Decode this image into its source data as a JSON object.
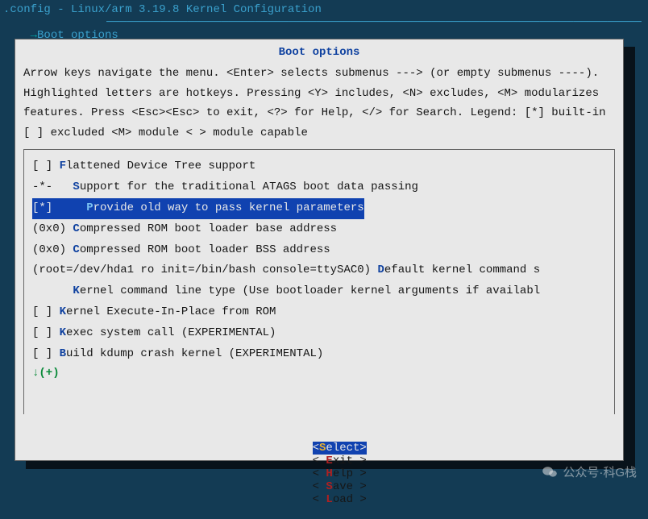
{
  "window_title": ".config - Linux/arm 3.19.8 Kernel Configuration",
  "breadcrumb": {
    "arrow": "→",
    "label": "Boot options"
  },
  "panel": {
    "title": "Boot options",
    "help": "Arrow keys navigate the menu.  <Enter> selects submenus ---> (or empty submenus ----).  Highlighted letters are hotkeys.  Pressing <Y> includes, <N> excludes, <M> modularizes features.  Press <Esc><Esc> to exit, <?> for Help, </> for Search.  Legend: [*] built-in  [ ] excluded  <M> module  < > module capable"
  },
  "options": [
    {
      "prefix": "[ ] ",
      "hk": "F",
      "rest": "lattened Device Tree support",
      "selected": false
    },
    {
      "prefix": "-*-   ",
      "hk": "S",
      "rest": "upport for the traditional ATAGS boot data passing",
      "selected": false
    },
    {
      "prefix": "[*]     ",
      "hk": "P",
      "rest": "rovide old way to pass kernel parameters",
      "selected": true
    },
    {
      "prefix": "(0x0) ",
      "hk": "C",
      "rest": "ompressed ROM boot loader base address",
      "selected": false
    },
    {
      "prefix": "(0x0) ",
      "hk": "C",
      "rest": "ompressed ROM boot loader BSS address",
      "selected": false
    },
    {
      "prefix": "(root=/dev/hda1 ro init=/bin/bash console=ttySAC0) ",
      "hk": "D",
      "rest": "efault kernel command s",
      "selected": false
    },
    {
      "prefix": "      ",
      "hk": "K",
      "rest": "ernel command line type (Use bootloader kernel arguments if availabl",
      "selected": false
    },
    {
      "prefix": "[ ] ",
      "hk": "K",
      "rest": "ernel Execute-In-Place from ROM",
      "selected": false
    },
    {
      "prefix": "[ ] ",
      "hk": "K",
      "rest": "exec system call (EXPERIMENTAL)",
      "selected": false
    },
    {
      "prefix": "[ ] ",
      "hk": "B",
      "rest": "uild kdump crash kernel (EXPERIMENTAL)",
      "selected": false
    }
  ],
  "more_indicator": "↓(+)",
  "buttons": [
    {
      "open": "<",
      "hk": "S",
      "rest": "elect",
      "close": ">",
      "selected": true
    },
    {
      "open": "< ",
      "hk": "E",
      "rest": "xit ",
      "close": ">",
      "selected": false
    },
    {
      "open": "< ",
      "hk": "H",
      "rest": "elp ",
      "close": ">",
      "selected": false
    },
    {
      "open": "< ",
      "hk": "S",
      "rest": "ave ",
      "close": ">",
      "selected": false
    },
    {
      "open": "< ",
      "hk": "L",
      "rest": "oad ",
      "close": ">",
      "selected": false
    }
  ],
  "watermark": "公众号·科G栈"
}
